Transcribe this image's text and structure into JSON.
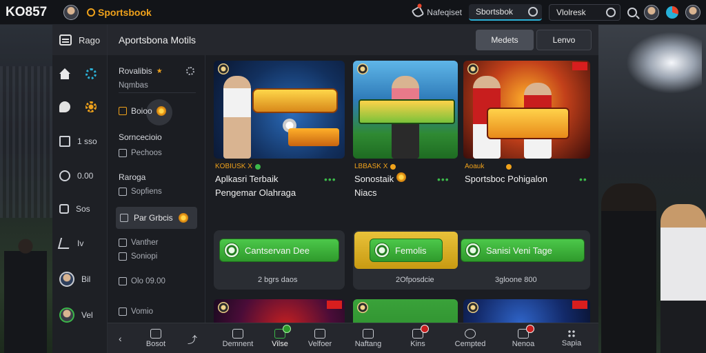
{
  "topbar": {
    "brand": "KO857",
    "site_name": "Sportsbook",
    "tool_label": "Nafeqiset",
    "search_value": "Sbortsbok",
    "search2_value": "Vlolresk"
  },
  "sidebar": {
    "head_label": "Rago",
    "items": [
      {
        "label": "",
        "icon": "home-icon"
      },
      {
        "label": "",
        "icon": "chat-icon"
      },
      {
        "label": "1 sso",
        "icon": "frame-icon"
      },
      {
        "label": "0.00",
        "icon": "ring-icon"
      },
      {
        "label": "Sos",
        "icon": "square-icon"
      },
      {
        "label": "Iv",
        "icon": "share-icon"
      },
      {
        "label": "Bil",
        "icon": "avatar"
      },
      {
        "label": "Vel",
        "icon": "avatar"
      }
    ]
  },
  "menu": {
    "favorites": "Rovalibis",
    "favorites_sub": "Nqmbas",
    "active_item": "Boioo",
    "section1": "Sorncecioio",
    "section1_sub": "Pechoos",
    "section2": "Raroga",
    "section2_sub": "Sopfiens",
    "selected": "Par Grbcis",
    "item_a": "Vanther",
    "item_b": "Soniopi",
    "item_c": "Olo 09.00",
    "item_d": "Vomio"
  },
  "main": {
    "title": "Aportsbona Motils",
    "btn_markets": "Medets",
    "btn_leave": "Lenvo"
  },
  "cards": [
    {
      "tag": "KOBIUSK X",
      "title_line1": "Aplkasri Terbaik",
      "title_line2": "Pengemar Olahraga",
      "button": "Cantservan Dee",
      "count": "2 bgrs daos"
    },
    {
      "tag": "LBBASK X",
      "title_line1": "Sonostaik",
      "title_line2": "Niacs",
      "button": "Femolis",
      "count": "2Ofposdcie"
    },
    {
      "tag": "Aoauk",
      "title_line1": "Sportsboc Pohigalon",
      "title_line2": "",
      "button": "Sanisi Veni Tage",
      "count": "3gloone 800"
    }
  ],
  "bottom_nav": [
    {
      "label": "Demnent",
      "icon": "dashboard-icon"
    },
    {
      "label": "Vilse",
      "icon": "video-icon",
      "badge": "green"
    },
    {
      "label": "Velfoer",
      "icon": "wallet-icon"
    },
    {
      "label": "Naftang",
      "icon": "hand-icon"
    },
    {
      "label": "Kins",
      "icon": "tag-icon",
      "badge": "red"
    },
    {
      "label": "Cempted",
      "icon": "headset-icon"
    },
    {
      "label": "Nenoa",
      "icon": "chat-icon",
      "badge": "red"
    },
    {
      "label": "Sapia",
      "icon": "grid-icon"
    }
  ],
  "bottom_left_label": "Bosot",
  "colors": {
    "accent_green": "#3cb84a",
    "accent_orange": "#f0a21b",
    "accent_blue": "#2bb0d6",
    "badge_red": "#c81e1e"
  }
}
